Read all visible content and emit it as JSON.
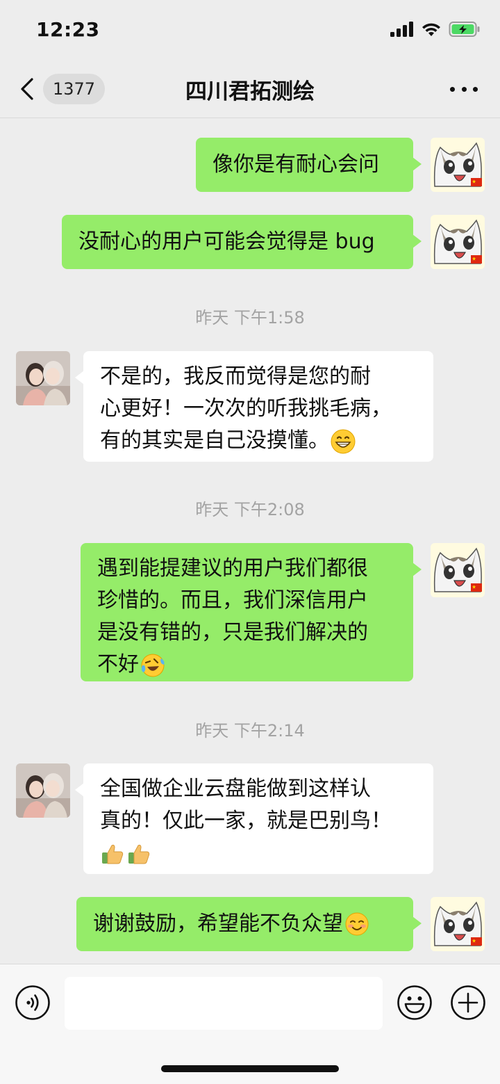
{
  "status_bar": {
    "time": "12:23"
  },
  "nav": {
    "back_count": "1377",
    "title": "四川君拓测绘"
  },
  "messages": {
    "m1": "像你是有耐心会问",
    "m2": "没耐心的用户可能会觉得是 bug",
    "t1": "昨天 下午1:58",
    "m3_l1": "不是的，我反而觉得是您的耐",
    "m3_l2": "心更好！一次次的听我挑毛病，",
    "m3_l3": "有的其实是自己没摸懂。",
    "t2": "昨天 下午2:08",
    "m4_l1": "遇到能提建议的用户我们都很",
    "m4_l2": "珍惜的。而且，我们深信用户",
    "m4_l3": "是没有错的，只是我们解决的",
    "m4_l4": "不好",
    "t3": "昨天 下午2:14",
    "m5_l1": "全国做企业云盘能做到这样认",
    "m5_l2": "真的！仅此一家，就是巴别鸟！",
    "m6": "谢谢鼓励，希望能不负众望"
  },
  "icons": {
    "battery": "battery-charging-icon",
    "emoji_grin": "grinning-emoji",
    "emoji_cry": "rolling-tears-emoji",
    "emoji_thumbs": "thumbs-up-emoji",
    "emoji_blush": "blush-emoji"
  },
  "colors": {
    "my_bubble": "#95ec69",
    "their_bubble": "#ffffff",
    "background": "#ededed"
  }
}
